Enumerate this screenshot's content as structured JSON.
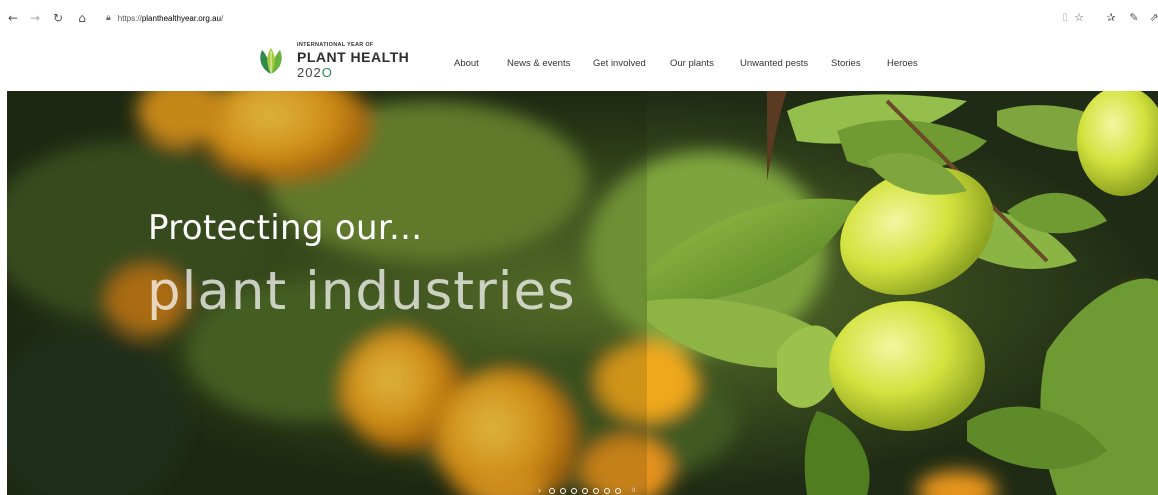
{
  "browser": {
    "url_scheme": "https://",
    "url_host": "planthealthyear.org.au",
    "url_path": "/"
  },
  "logo": {
    "small_text": "INTERNATIONAL YEAR OF",
    "main_text": "PLANT HEALTH",
    "year_part1": "2",
    "year_o": "0",
    "year_part2": "2",
    "year_o2": "O"
  },
  "nav": {
    "items": [
      {
        "label": "About"
      },
      {
        "label": "News & events"
      },
      {
        "label": "Get involved"
      },
      {
        "label": "Our plants"
      },
      {
        "label": "Unwanted pests"
      },
      {
        "label": "Stories"
      },
      {
        "label": "Heroes"
      }
    ]
  },
  "hero": {
    "title": "Protecting our...",
    "subtitle": "plant industries",
    "slide_count": 7,
    "active_slide": 1
  },
  "colors": {
    "accent_green": "#2f8a4c",
    "leaf_green": "#5a8a2a",
    "lemon": "#d9e84a",
    "orange": "#f2a21a"
  }
}
